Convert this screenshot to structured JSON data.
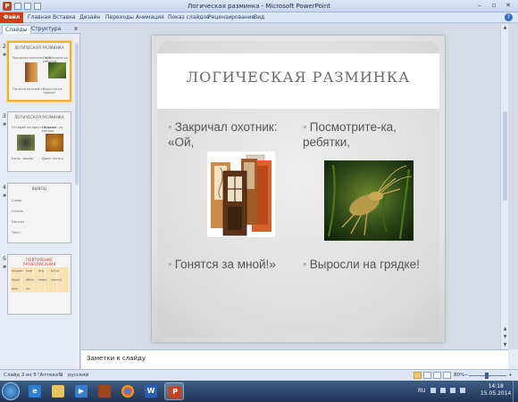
{
  "window": {
    "title": "Логическая разминка - Microsoft PowerPoint",
    "app_icon": "P"
  },
  "ribbon": {
    "tabs": [
      "Файл",
      "Главная",
      "Вставка",
      "Дизайн",
      "Переходы",
      "Анимация",
      "Показ слайдов",
      "Рецензирование",
      "Вид"
    ]
  },
  "left_pane": {
    "tabs": [
      "Слайды",
      "Структура"
    ],
    "close": "x",
    "thumbs": [
      {
        "number": "2",
        "title": "ЛОГИЧЕСКАЯ РАЗМИНКА",
        "lines": [
          "Закричал охотник: «Ой,",
          "Посмотрите-ка, ребятки,",
          "Гонятся за мной!»",
          "Выросли на грядке!"
        ]
      },
      {
        "number": "3",
        "title": "ЛОГИЧЕСКАЯ РАЗМИНКА",
        "lines": [
          "Отгадай загадку и будешь",
          "Ни колёс, ни мотора,",
          "Ежик, зверёк",
          "Даже лететь"
        ]
      },
      {
        "number": "4",
        "title": "ВЫВОД",
        "lines": [
          "Слова",
          "Сказка",
          "Рассказ",
          "Текст"
        ]
      },
      {
        "number": "5",
        "title": "ПОВТОРЕНИЕ ПРАВОПИСАНИЯ",
        "lines": [
          "пишем",
          "мне",
          "его",
          "речи",
          "вода",
          "обла",
          "мира",
          "кошка",
          "имя",
          "не"
        ]
      }
    ]
  },
  "slide": {
    "title": "ЛОГИЧЕСКАЯ РАЗМИНКА",
    "bullets": {
      "left_top": "Закричал охотник: «Ой,",
      "right_top": "Посмотрите-ка, ребятки,",
      "left_bottom": "Гонятся за мной!»",
      "right_bottom": "Выросли на грядке!"
    }
  },
  "notes": {
    "placeholder": "Заметки к слайду"
  },
  "status_bar": {
    "slide_info": "Слайд 2 из 5",
    "theme": "\"Аптека\"",
    "language": "русский",
    "zoom": "80%"
  },
  "taskbar": {
    "language": "RU",
    "time": "14:18",
    "date": "15.05.2014"
  },
  "colors": {
    "file_tab": "#c7421c",
    "selected_thumb": "#f0b02f",
    "slide_title": "#6a6a6a",
    "bullet_text": "#555555"
  }
}
